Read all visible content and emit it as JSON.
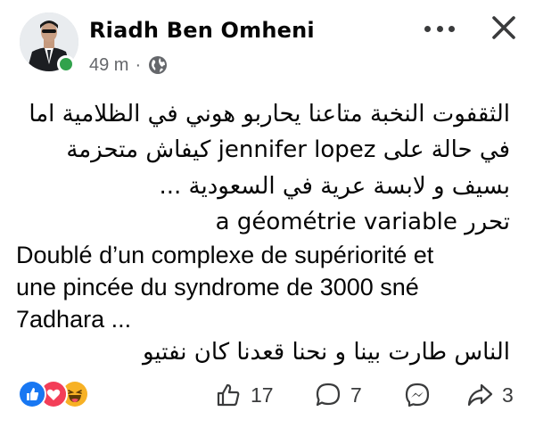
{
  "post": {
    "author": "Riadh Ben Omheni",
    "time": "49 m",
    "separator": "·",
    "audience_icon": "globe-icon",
    "online_color": "#31a24c",
    "body_lines": [
      "الثقفوت النخبة   متاعنا يحاربو هوني في الظلامية اما",
      "في حالة على jennifer lopez كيفاش متحزمة",
      "بسيف و لابسة  عرية في السعودية ...",
      "تحرر a géométrie variable",
      "Doublé d’un complexe de supériorité et",
      "une pincée du syndrome de 3000 sné",
      "7adhara  ...",
      "الناس طارت بينا و نحنا قعدنا كان نفتيو"
    ],
    "reactions": [
      "like-icon",
      "love-icon",
      "haha-icon"
    ],
    "actions": {
      "like": {
        "icon": "thumbs-up-icon",
        "count": "17"
      },
      "comment": {
        "icon": "comment-icon",
        "count": "7"
      },
      "messenger": {
        "icon": "messenger-icon"
      },
      "share": {
        "icon": "share-icon",
        "count": "3"
      }
    }
  }
}
